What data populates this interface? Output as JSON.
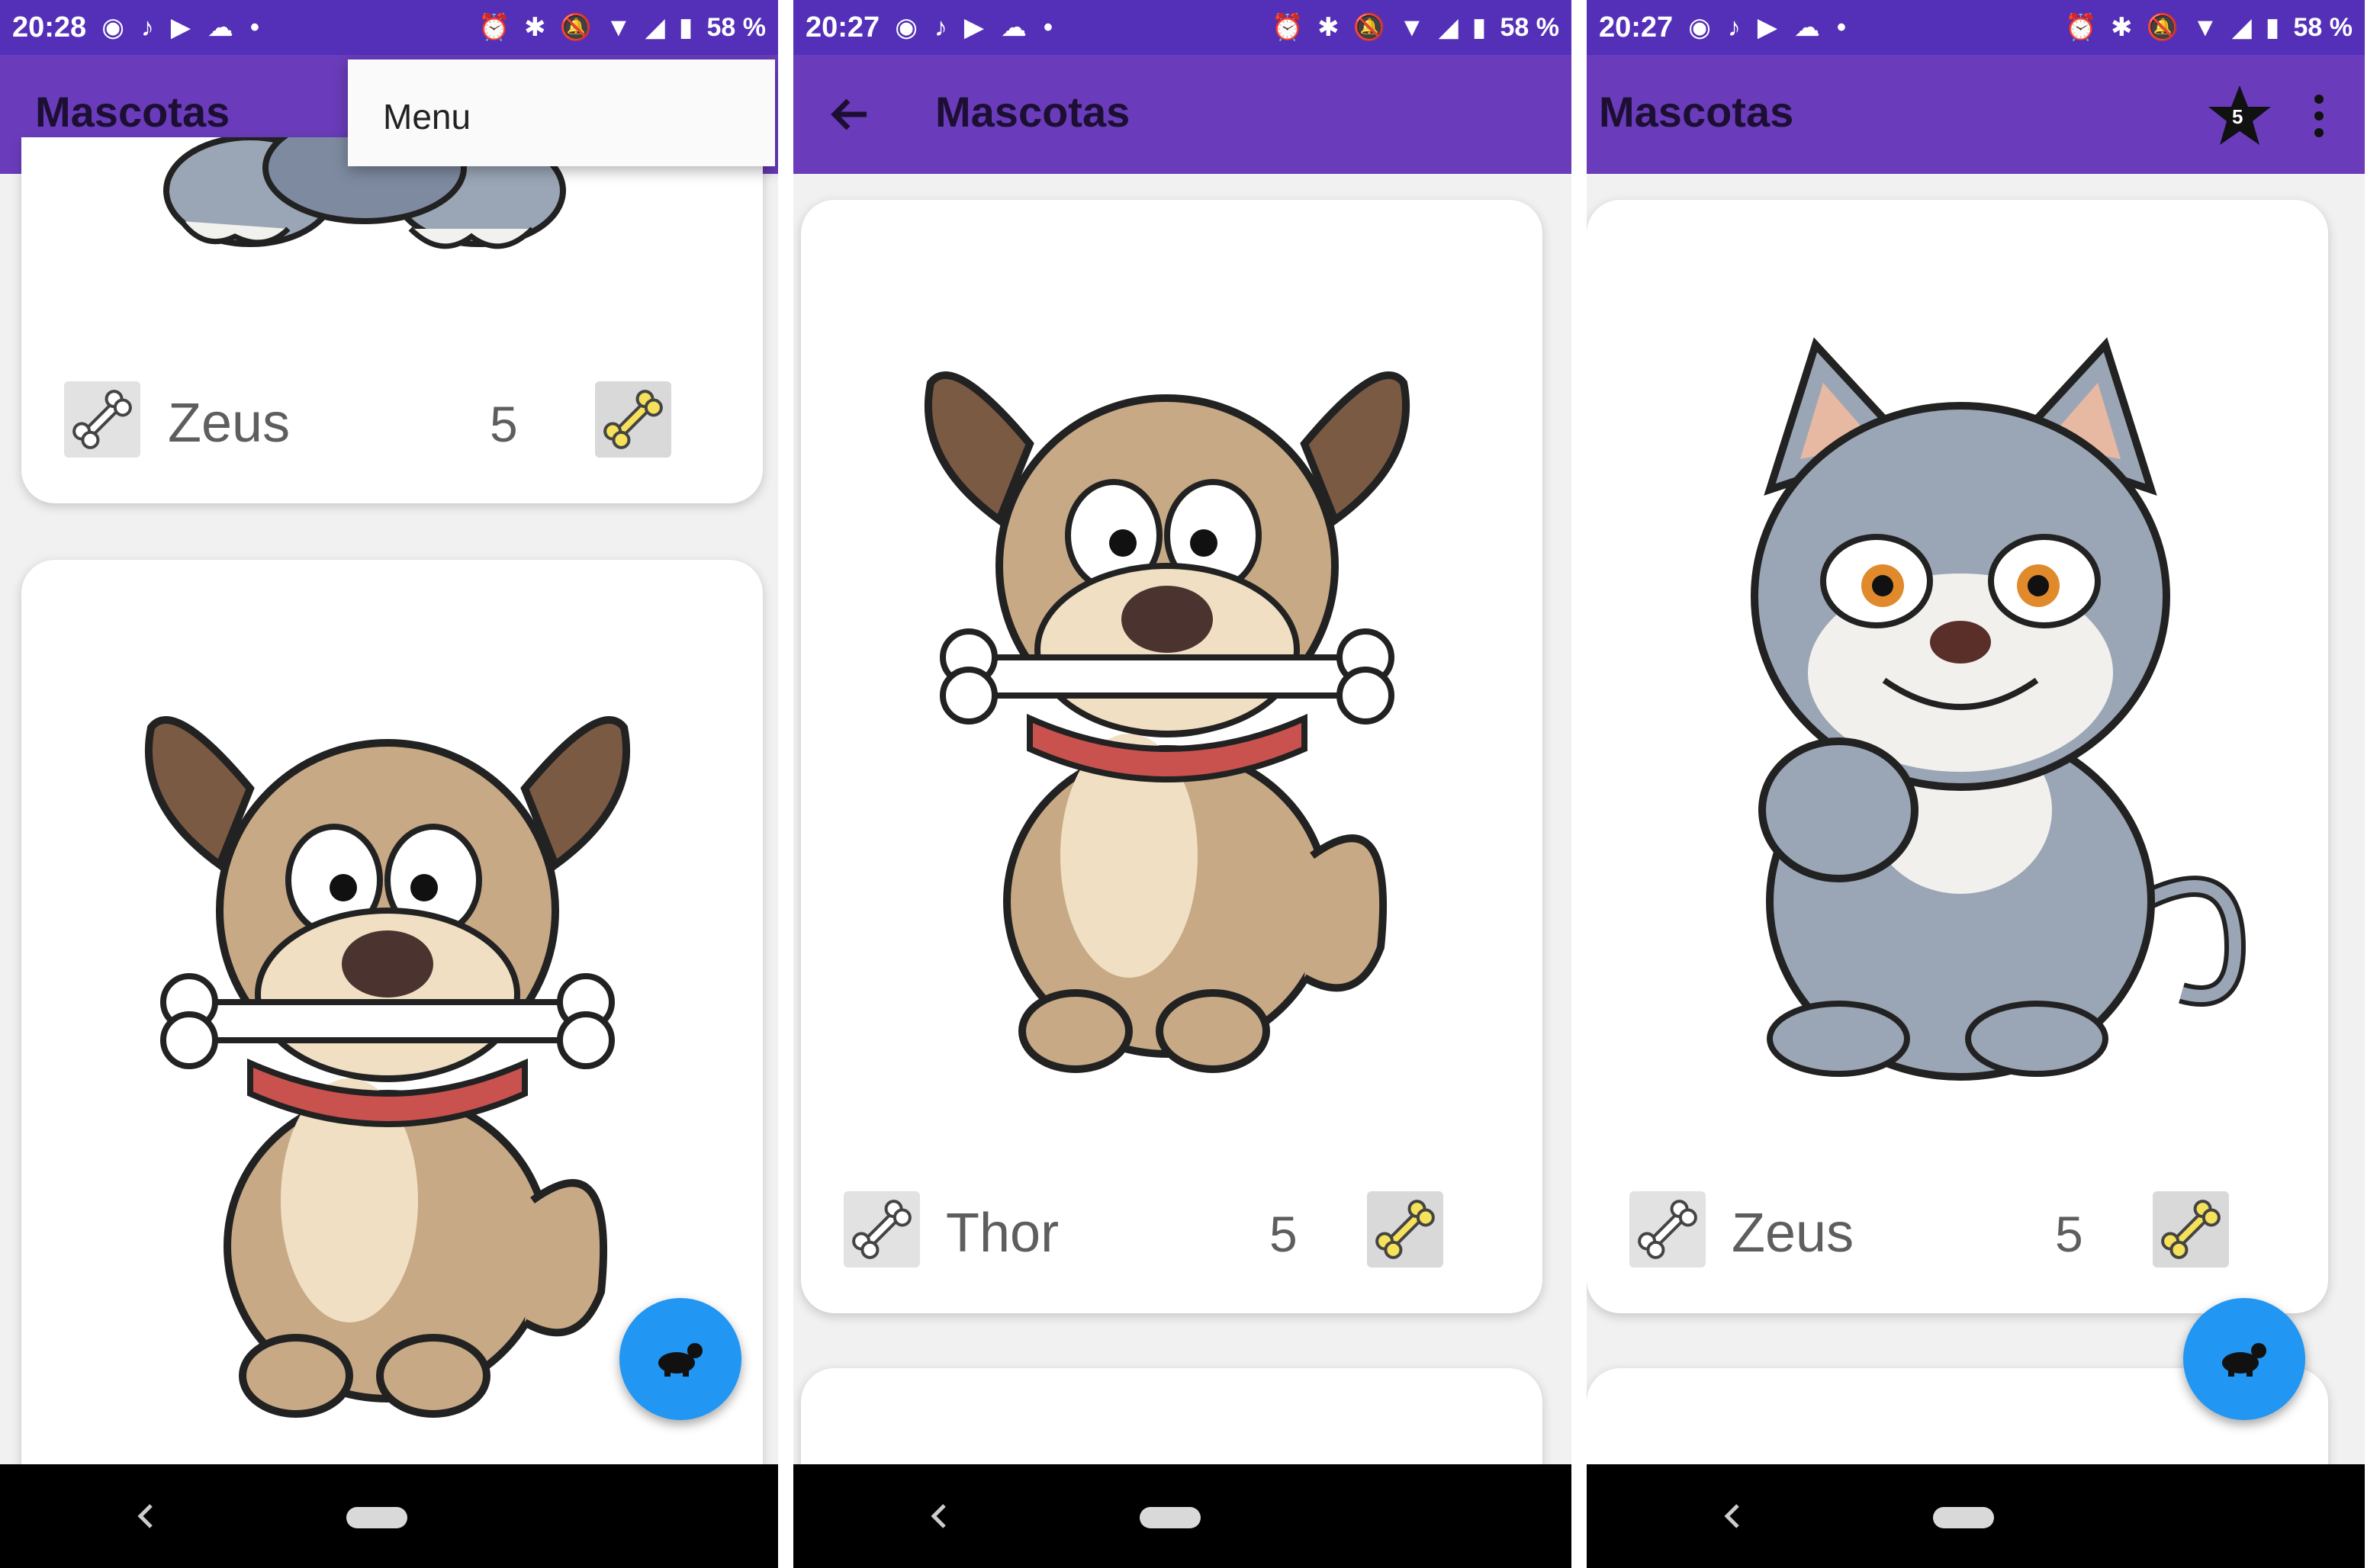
{
  "colors": {
    "status_bar": "#5430b8",
    "toolbar": "#6a3cbb",
    "fab": "#2196f3",
    "nav_bar": "#000000"
  },
  "phones": [
    {
      "status": {
        "time": "20:28",
        "battery": "58 %"
      },
      "app_title": "Mascotas",
      "menu": {
        "item": "Menu"
      },
      "card": {
        "name": "Zeus",
        "count": "5"
      }
    },
    {
      "status": {
        "time": "20:27",
        "battery": "58 %"
      },
      "app_title": "Mascotas",
      "card": {
        "name": "Thor",
        "count": "5"
      }
    },
    {
      "status": {
        "time": "20:27",
        "battery": "58 %"
      },
      "app_title": "Mascotas",
      "star_badge": "5",
      "card": {
        "name": "Zeus",
        "count": "5"
      }
    }
  ]
}
